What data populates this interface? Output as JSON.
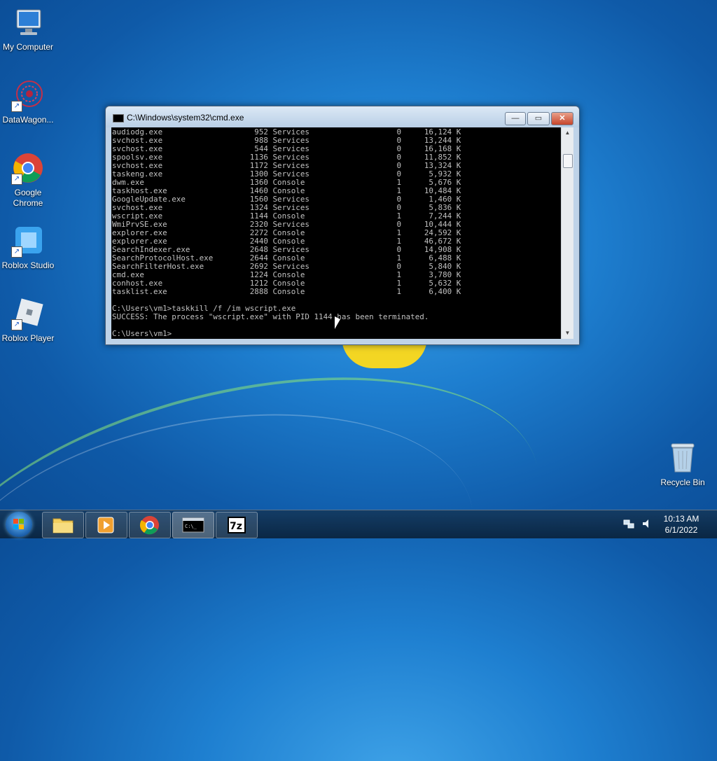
{
  "desktop": {
    "icons": [
      {
        "label": "My Computer"
      },
      {
        "label": "DataWagon..."
      },
      {
        "label": "Google Chrome"
      },
      {
        "label": "Roblox Studio"
      },
      {
        "label": "Roblox Player"
      },
      {
        "label": "Recycle Bin"
      }
    ]
  },
  "cmd_window": {
    "title": "C:\\Windows\\system32\\cmd.exe",
    "minimize_label": "—",
    "maximize_label": "▭",
    "close_label": "✕",
    "console_text": "audiodg.exe                    952 Services                   0     16,124 K\nsvchost.exe                    988 Services                   0     13,244 K\nsvchost.exe                    544 Services                   0     16,168 K\nspoolsv.exe                   1136 Services                   0     11,852 K\nsvchost.exe                   1172 Services                   0     13,324 K\ntaskeng.exe                   1300 Services                   0      5,932 K\ndwm.exe                       1360 Console                    1      5,676 K\ntaskhost.exe                  1460 Console                    1     10,484 K\nGoogleUpdate.exe              1560 Services                   0      1,460 K\nsvchost.exe                   1324 Services                   0      5,836 K\nwscript.exe                   1144 Console                    1      7,244 K\nWmiPrvSE.exe                  2320 Services                   0     10,444 K\nexplorer.exe                  2272 Console                    1     24,592 K\nexplorer.exe                  2440 Console                    1     46,672 K\nSearchIndexer.exe             2648 Services                   0     14,908 K\nSearchProtocolHost.exe        2644 Console                    1      6,488 K\nSearchFilterHost.exe          2692 Services                   0      5,840 K\ncmd.exe                       1224 Console                    1      3,780 K\nconhost.exe                   1212 Console                    1      5,632 K\ntasklist.exe                  2888 Console                    1      6,400 K\n\nC:\\Users\\vm1>taskkill /f /im wscript.exe\nSUCCESS: The process \"wscript.exe\" with PID 1144 has been terminated.\n\nC:\\Users\\vm1>"
  },
  "taskbar": {
    "clock_time": "10:13 AM",
    "clock_date": "6/1/2022",
    "apps": [
      {
        "icon": "folder-icon"
      },
      {
        "icon": "media-player-icon"
      },
      {
        "icon": "chrome-icon"
      },
      {
        "icon": "cmd-icon"
      },
      {
        "icon": "7zip-icon",
        "label": "7z"
      }
    ]
  },
  "colors": {
    "console_bg": "#000000",
    "console_fg": "#c0c0c0",
    "desktop_blue": "#1e7fd0"
  }
}
